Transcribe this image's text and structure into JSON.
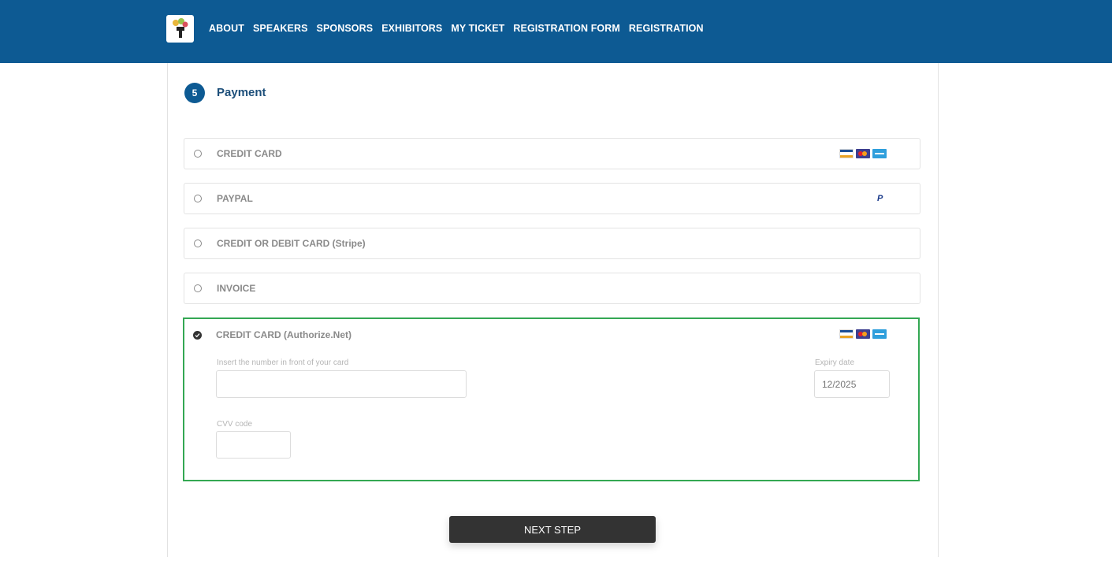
{
  "nav": {
    "items": [
      "ABOUT",
      "SPEAKERS",
      "SPONSORS",
      "EXHIBITORS",
      "MY TICKET",
      "REGISTRATION FORM",
      "REGISTRATION"
    ]
  },
  "step": {
    "number": "5",
    "title": "Payment"
  },
  "payment_options": [
    {
      "label": "CREDIT CARD",
      "icons": [
        "visa-icon",
        "mastercard-icon",
        "amex-icon"
      ],
      "selected": false
    },
    {
      "label": "PAYPAL",
      "icons": [
        "paypal-icon"
      ],
      "selected": false
    },
    {
      "label": "CREDIT OR DEBIT CARD (Stripe)",
      "icons": [],
      "selected": false
    },
    {
      "label": "INVOICE",
      "icons": [],
      "selected": false
    },
    {
      "label": "CREDIT CARD (Authorize.Net)",
      "icons": [
        "visa-icon",
        "mastercard-icon",
        "amex-icon"
      ],
      "selected": true
    }
  ],
  "card_form": {
    "number_label": "Insert the number in front of your card",
    "number_value": "",
    "expiry_label": "Expiry date",
    "expiry_placeholder": "12/2025",
    "cvv_label": "CVV code",
    "cvv_value": ""
  },
  "paypal_mark": "P",
  "next_button": "NEXT STEP",
  "colors": {
    "header": "#0d5a93",
    "selected_border": "#34a853",
    "button": "#333333"
  }
}
